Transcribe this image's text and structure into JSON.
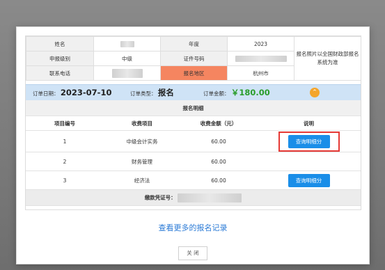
{
  "info": {
    "name_label": "姓名",
    "year_label": "年度",
    "year_value": "2023",
    "level_label": "申报级别",
    "level_value": "中级",
    "idno_label": "证件号码",
    "phone_label": "联系电话",
    "region_label": "报名地区",
    "region_value": "杭州市",
    "note": "报名照片以全国财政部报名系统为准"
  },
  "order": {
    "date_label": "订单日期：",
    "date_value": "2023-07-10",
    "type_label": "订单类型：",
    "type_value": "报名",
    "amount_label": "订单金额：",
    "amount_value": "￥180.00",
    "toggle_icon": "chevron-up-icon"
  },
  "detail": {
    "title": "报名明细",
    "headers": [
      "项目编号",
      "收费项目",
      "收费金额（元）",
      "说明"
    ],
    "rows": [
      {
        "no": "1",
        "item": "中级会计实务",
        "amount": "60.00",
        "btn": "查询明细分"
      },
      {
        "no": "2",
        "item": "财务管理",
        "amount": "60.00",
        "btn": ""
      },
      {
        "no": "3",
        "item": "经济法",
        "amount": "60.00",
        "btn": "查询明细分"
      }
    ],
    "voucher_label": "缴款凭证号："
  },
  "more_link": "查看更多的报名记录",
  "close_label": "关 闭",
  "colors": {
    "accent": "#1a8ee8",
    "region_bg": "#f58560",
    "money": "#2a8f2a",
    "highlight_border": "#e53935"
  }
}
